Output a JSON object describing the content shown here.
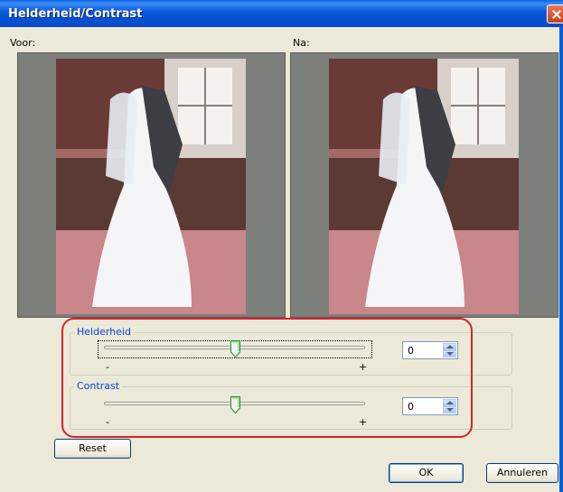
{
  "window": {
    "title": "Helderheid/Contrast"
  },
  "previews": {
    "before_label": "Voor:",
    "after_label": "Na:"
  },
  "brightness": {
    "label": "Helderheid",
    "min_label": "-",
    "max_label": "+",
    "value": "0",
    "slider_level": 0.5
  },
  "contrast": {
    "label": "Contrast",
    "min_label": "-",
    "max_label": "+",
    "value": "0",
    "slider_level": 0.5
  },
  "buttons": {
    "reset": "Reset",
    "ok": "OK",
    "cancel": "Annuleren"
  },
  "colors": {
    "title_bar": "#0a58d8",
    "dialog_bg": "#ece9d8",
    "group_label": "#0046d5",
    "highlight": "#d9202c"
  },
  "icons": {
    "close": "close-icon",
    "slider_thumb": "slider-thumb-icon",
    "spin_up": "spin-up-icon",
    "spin_down": "spin-down-icon"
  }
}
